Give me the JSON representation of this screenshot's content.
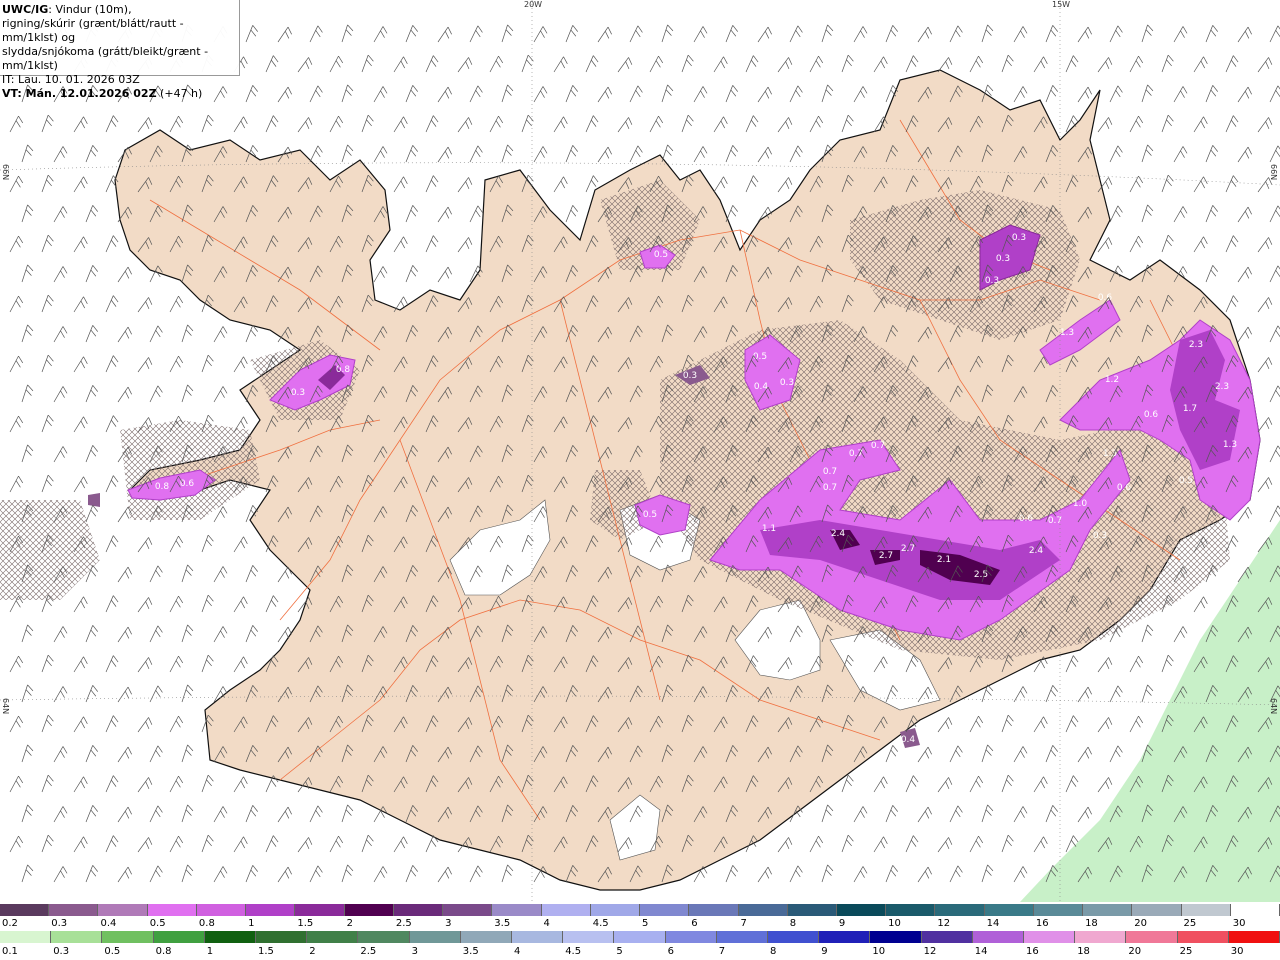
{
  "info": {
    "model": "UWC/IG",
    "line1_rest": ": Vindur (10m),",
    "line2": "rigning/skúrir (grænt/blátt/rautt - mm/1klst) og",
    "line3": "slydda/snjókoma (grátt/bleikt/grænt - mm/1klst)",
    "line4": "IT: Lau. 10. 01. 2026 03Z",
    "vt": "VT: Mán. 12.01.2026 02Z",
    "vt_rest": " (+47 h)"
  },
  "axes": {
    "top_left": "20W",
    "top_right": "15W",
    "left_top": "66N",
    "left_bottom": "64N",
    "right_top": "66N",
    "right_bottom": "64N"
  },
  "precip_labels": [
    "0.5",
    "0.8",
    "0.3",
    "0.8",
    "0.6",
    "0.5",
    "0.3",
    "0.3",
    "0.3",
    "0.5",
    "0.4",
    "0.3",
    "0.3",
    "0.7",
    "0.7",
    "0.7",
    "0.7",
    "1.1",
    "2.4",
    "2.7",
    "2.7",
    "2.1",
    "2.5",
    "2.4",
    "0.6",
    "0.7",
    "1.0",
    "0.3",
    "1.3",
    "0.6",
    "1.2",
    "2.3",
    "2.3",
    "1.7",
    "0.6",
    "1.3",
    "0.5",
    "1.3",
    "0.6",
    "0.4"
  ],
  "legend_snow": {
    "labels": [
      "0.2",
      "0.3",
      "0.4",
      "0.5",
      "0.8",
      "1",
      "1.5",
      "2",
      "2.5",
      "3",
      "3.5",
      "4",
      "4.5",
      "5",
      "6",
      "7",
      "8",
      "9",
      "10",
      "12",
      "14",
      "16",
      "18",
      "20",
      "25",
      "30"
    ],
    "colors": [
      "#5a3a5e",
      "#8a5a8e",
      "#b07ab8",
      "#e070f0",
      "#d060e0",
      "#b040c8",
      "#8a2a9a",
      "#500050",
      "#6a2a7a",
      "#7a4a8a",
      "#9a8ac8",
      "#b0b0f0",
      "#a0a8e8",
      "#8088d0",
      "#6a78b8",
      "#4a6a98",
      "#2a5a78",
      "#0a4a5a",
      "#1a5a6a",
      "#2a6a7a",
      "#3a7a88",
      "#5a8a98",
      "#7a9aa8",
      "#9aaab8",
      "#c0c8d0",
      "#ffffff"
    ]
  },
  "legend_rain": {
    "labels": [
      "0.1",
      "0.3",
      "0.5",
      "0.8",
      "1",
      "1.5",
      "2",
      "2.5",
      "3",
      "3.5",
      "4",
      "4.5",
      "5",
      "6",
      "7",
      "8",
      "9",
      "10",
      "12",
      "14",
      "16",
      "18",
      "20",
      "25",
      "30"
    ],
    "colors": [
      "#d8f5d0",
      "#a8e098",
      "#70c060",
      "#40a040",
      "#106010",
      "#307030",
      "#408048",
      "#508860",
      "#709898",
      "#90a8b8",
      "#a8b8e0",
      "#b8c0f0",
      "#a8b0f0",
      "#8088e0",
      "#6070d8",
      "#4050d0",
      "#2020b8",
      "#000090",
      "#5030a0",
      "#b060d8",
      "#e090e8",
      "#f0a8d0",
      "#f07898",
      "#f05060",
      "#f01010"
    ]
  },
  "colors": {
    "land": "#f2dbc6",
    "coast": "#111111",
    "roads": "#f07040",
    "glacier": "#ffffff",
    "rain_green": "#c8f0c8",
    "precip_dark": "#500050",
    "precip_mid": "#b040c8",
    "precip_light": "#e070f0"
  }
}
